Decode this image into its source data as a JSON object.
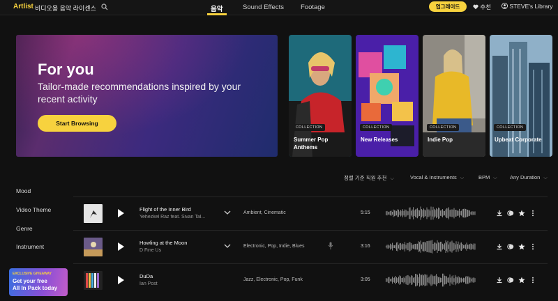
{
  "topbar": {
    "logo": "Artlist",
    "tagline": "비디오용 음악 라이센스",
    "tabs": [
      {
        "label": "음악",
        "active": true
      },
      {
        "label": "Sound Effects",
        "active": false
      },
      {
        "label": "Footage",
        "active": false
      }
    ],
    "upgrade_label": "업그레이드",
    "favorites_label": "추천",
    "library_label": "STEVE's Library"
  },
  "hero": {
    "title": "For you",
    "subtitle": "Tailor-made recommendations inspired by your recent activity",
    "button_label": "Start Browsing"
  },
  "collections": [
    {
      "badge": "COLLECTION",
      "title": "Summer Pop Anthems"
    },
    {
      "badge": "COLLECTION",
      "title": "New Releases"
    },
    {
      "badge": "COLLECTION",
      "title": "Indie Pop"
    },
    {
      "badge": "COLLECTION",
      "title": "Upbeat Corporate"
    }
  ],
  "filters": {
    "sort": "정렬 기준 직원 추천",
    "vocal": "Vocal & Instruments",
    "bpm": "BPM",
    "duration": "Any Duration"
  },
  "sidebar": {
    "items": [
      "Mood",
      "Video Theme",
      "Genre",
      "Instrument"
    ]
  },
  "promo": {
    "small": "EXCLUSIVE GIVEAWAY",
    "line1": "Get your free",
    "line2": "All In Pack today"
  },
  "tracks": [
    {
      "title": "Flight of the Inner Bird",
      "artist": "Yehezkel Raz feat. Sivan Tal...",
      "tags": "Ambient,  Cinematic",
      "duration": "5:15",
      "expandable": true,
      "vocals": false
    },
    {
      "title": "Howling at the Moon",
      "artist": "D Fine Us",
      "tags": "Electronic,  Pop,  Indie,  Blues",
      "duration": "3:16",
      "expandable": true,
      "vocals": true
    },
    {
      "title": "DuDa",
      "artist": "Ian Post",
      "tags": "Jazz,  Electronic,  Pop,  Funk",
      "duration": "3:05",
      "expandable": false,
      "vocals": false
    }
  ],
  "colors": {
    "accent": "#f7d23e",
    "background": "#111111"
  }
}
